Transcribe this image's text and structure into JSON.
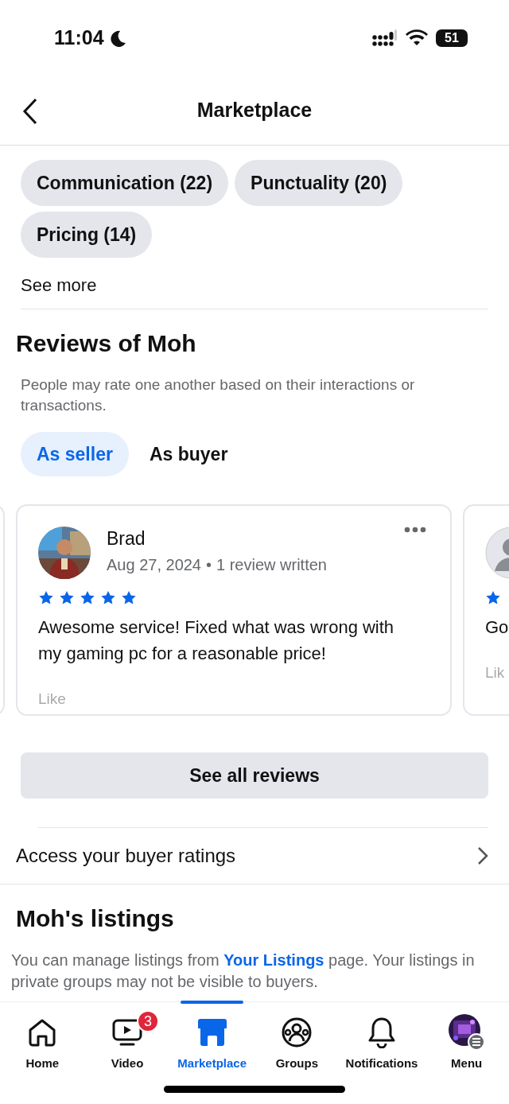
{
  "status_bar": {
    "time": "11:04",
    "battery": "51"
  },
  "header": {
    "title": "Marketplace"
  },
  "tags": [
    {
      "label": "Communication (22)"
    },
    {
      "label": "Punctuality (20)"
    },
    {
      "label": "Pricing (14)"
    }
  ],
  "see_more": "See more",
  "reviews": {
    "title": "Reviews of Moh",
    "description": "People may rate one another based on their interactions or transactions.",
    "tabs": [
      {
        "label": "As seller",
        "selected": true
      },
      {
        "label": "As buyer",
        "selected": false
      }
    ],
    "cards": [
      {
        "kind": "full",
        "name": "Brad",
        "date": "Aug 27, 2024",
        "separator": "•",
        "meta": "1 review written",
        "stars": 5,
        "text": "Awesome service! Fixed what was wrong with my gaming pc for a reasonable price!",
        "like": "Like"
      },
      {
        "kind": "partial",
        "text": "Go",
        "like": "Lik"
      }
    ]
  },
  "see_all": "See all reviews",
  "buyer_ratings": "Access your buyer ratings",
  "listings": {
    "title": "Moh's listings",
    "text_before": "You can manage listings from ",
    "link": "Your Listings",
    "text_after": " page. Your listings in private groups may not be visible to buyers."
  },
  "nav": [
    {
      "label": "Home",
      "selected": false
    },
    {
      "label": "Video",
      "selected": false,
      "badge": "3"
    },
    {
      "label": "Marketplace",
      "selected": true
    },
    {
      "label": "Groups",
      "selected": false
    },
    {
      "label": "Notifications",
      "selected": false
    },
    {
      "label": "Menu",
      "selected": false
    }
  ]
}
